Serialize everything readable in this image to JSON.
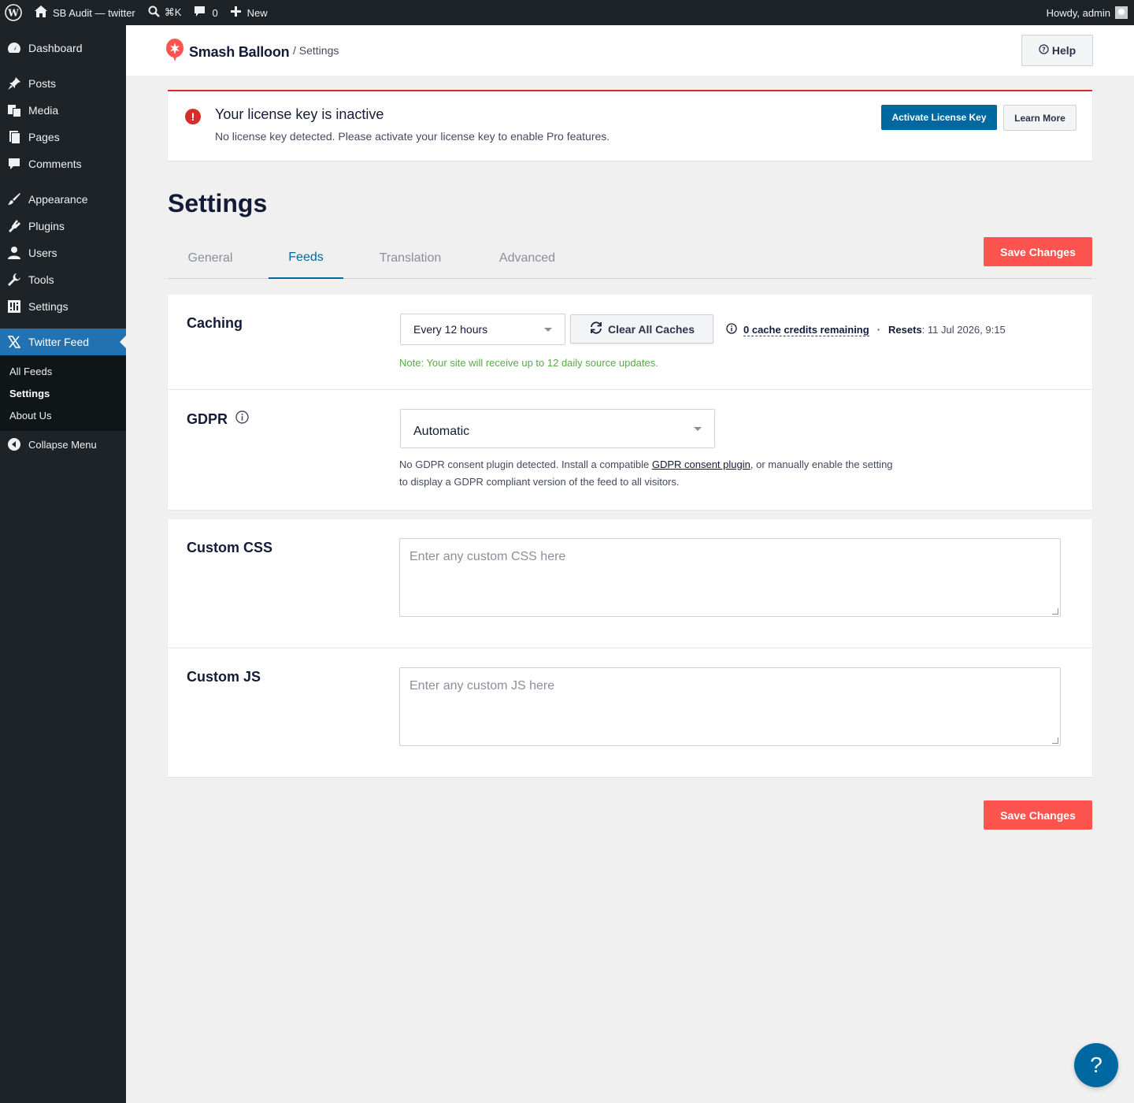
{
  "adminbar": {
    "site_name": "SB Audit — twitter",
    "shortcut": "⌘K",
    "comments_count": "0",
    "new_label": "New",
    "greeting": "Howdy, admin"
  },
  "sidebar": {
    "items": [
      {
        "label": "Dashboard",
        "icon": "dashboard-icon"
      },
      {
        "label": "Posts",
        "icon": "pin-icon"
      },
      {
        "label": "Media",
        "icon": "media-icon"
      },
      {
        "label": "Pages",
        "icon": "pages-icon"
      },
      {
        "label": "Comments",
        "icon": "comment-icon"
      },
      {
        "label": "Appearance",
        "icon": "brush-icon"
      },
      {
        "label": "Plugins",
        "icon": "plug-icon"
      },
      {
        "label": "Users",
        "icon": "user-icon"
      },
      {
        "label": "Tools",
        "icon": "wrench-icon"
      },
      {
        "label": "Settings",
        "icon": "settings-sliders-icon"
      },
      {
        "label": "Twitter Feed",
        "icon": "x-logo-icon"
      }
    ],
    "submenu": [
      "All Feeds",
      "Settings",
      "About Us"
    ],
    "collapse_label": "Collapse Menu"
  },
  "header": {
    "brand": "Smash Balloon",
    "breadcrumb": "/ Settings",
    "help_label": "Help"
  },
  "license_notice": {
    "title": "Your license key is inactive",
    "description": "No license key detected. Please activate your license key to enable Pro features.",
    "activate_label": "Activate License Key",
    "learn_more_label": "Learn More"
  },
  "page": {
    "title": "Settings",
    "save_label": "Save Changes"
  },
  "tabs": [
    {
      "label": "General",
      "active": false
    },
    {
      "label": "Feeds",
      "active": true
    },
    {
      "label": "Translation",
      "active": false
    },
    {
      "label": "Advanced",
      "active": false
    }
  ],
  "caching": {
    "label": "Caching",
    "selected": "Every 12 hours",
    "clear_label": "Clear All Caches",
    "credits_link": "0 cache credits remaining",
    "separator": "·",
    "resets_label": "Resets",
    "resets_value": ": 11 Jul 2026, 9:15",
    "note": "Note: Your site will receive up to 12 daily source updates."
  },
  "gdpr": {
    "label": "GDPR",
    "selected": "Automatic",
    "desc_before": "No GDPR consent plugin detected. Install a compatible ",
    "desc_link": "GDPR consent plugin",
    "desc_after": ", or manually enable the setting to display a GDPR compliant version of the feed to all visitors."
  },
  "custom_css": {
    "label": "Custom CSS",
    "placeholder": "Enter any custom CSS here"
  },
  "custom_js": {
    "label": "Custom JS",
    "placeholder": "Enter any custom JS here"
  },
  "fab": {
    "label": "?"
  },
  "colors": {
    "accent": "#0068a0",
    "save": "#fe544f",
    "error": "#d72c2c",
    "note_green": "#59ab46"
  }
}
